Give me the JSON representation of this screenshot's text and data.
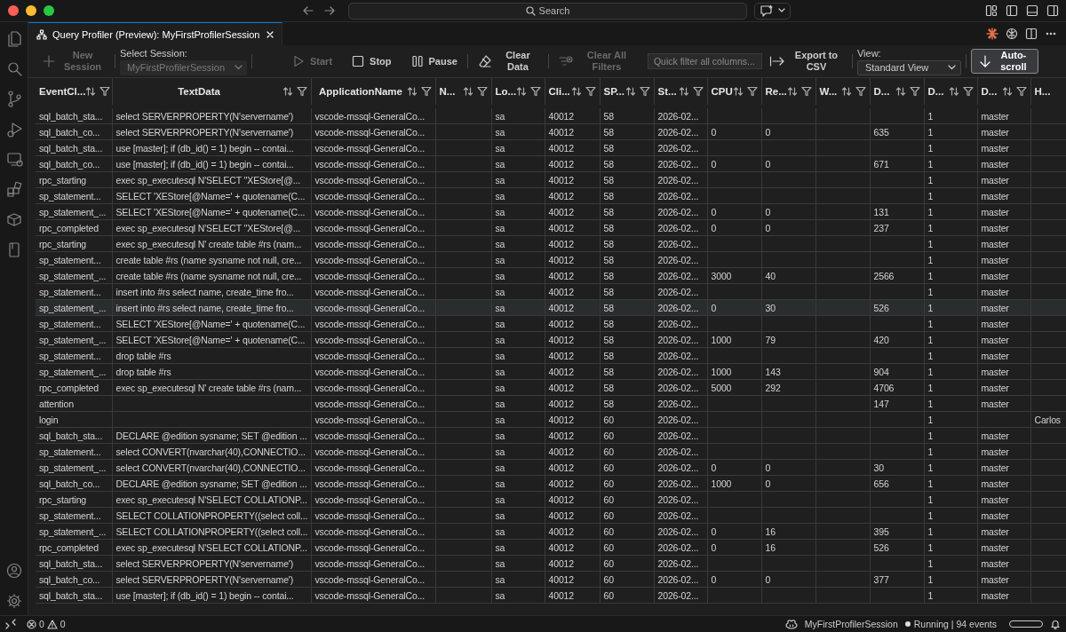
{
  "title_bar": {
    "search": "Search"
  },
  "tab": {
    "title": "Query Profiler (Preview): MyFirstProfilerSession",
    "selected": true
  },
  "toolbar": [
    {
      "kind": "button",
      "label": "New Session",
      "disabled": true
    },
    {
      "kind": "dropdown",
      "label": "Select Session:",
      "value": "MyFirstProfilerSession",
      "disabled": true
    },
    {
      "kind": "button",
      "label": "Start",
      "disabled": true
    },
    {
      "kind": "button",
      "label": "Stop",
      "disabled": false
    },
    {
      "kind": "button",
      "label": "Pause",
      "disabled": false
    },
    {
      "kind": "button",
      "label": "Clear Data",
      "disabled": false
    },
    {
      "kind": "button",
      "label": "Clear All Filters",
      "disabled": true
    },
    {
      "kind": "filter",
      "placeholder": "Quick filter all columns..."
    },
    {
      "kind": "button",
      "label": "Export to CSV",
      "disabled": false
    },
    {
      "kind": "dropdown",
      "label": "View:",
      "value": "Standard View",
      "disabled": false
    },
    {
      "kind": "toggle",
      "label": "Auto-scroll",
      "on": true
    }
  ],
  "table": {
    "columns": [
      "EventCl...",
      "TextData",
      "ApplicationName",
      "N...",
      "Lo...",
      "Cli...",
      "SP...",
      "St...",
      "CPU",
      "Re...",
      "W...",
      "D...",
      "D...",
      "D...",
      "H..."
    ],
    "rows": [
      {
        "selected": false,
        "cells": [
          "sql_batch_sta...",
          "select SERVERPROPERTY(N'servername')",
          "vscode-mssql-GeneralCo...",
          null,
          "sa",
          "40012",
          "58",
          "2026-02...",
          null,
          null,
          null,
          null,
          "1",
          "master",
          null
        ]
      },
      {
        "selected": false,
        "cells": [
          "sql_batch_co...",
          "select SERVERPROPERTY(N'servername')",
          "vscode-mssql-GeneralCo...",
          null,
          "sa",
          "40012",
          "58",
          "2026-02...",
          "0",
          "0",
          null,
          "635",
          "1",
          "master",
          null
        ]
      },
      {
        "selected": false,
        "cells": [
          "sql_batch_sta...",
          "use [master]; if (db_id() = 1) begin -- contai...",
          "vscode-mssql-GeneralCo...",
          null,
          "sa",
          "40012",
          "58",
          "2026-02...",
          null,
          null,
          null,
          null,
          "1",
          "master",
          null
        ]
      },
      {
        "selected": false,
        "cells": [
          "sql_batch_co...",
          "use [master]; if (db_id() = 1) begin -- contai...",
          "vscode-mssql-GeneralCo...",
          null,
          "sa",
          "40012",
          "58",
          "2026-02...",
          "0",
          "0",
          null,
          "671",
          "1",
          "master",
          null
        ]
      },
      {
        "selected": false,
        "cells": [
          "rpc_starting",
          "exec sp_executesql N'SELECT ''XEStore[@...",
          "vscode-mssql-GeneralCo...",
          null,
          "sa",
          "40012",
          "58",
          "2026-02...",
          null,
          null,
          null,
          null,
          "1",
          "master",
          null
        ]
      },
      {
        "selected": false,
        "cells": [
          "sp_statement...",
          "SELECT 'XEStore[@Name=' + quotename(C...",
          "vscode-mssql-GeneralCo...",
          null,
          "sa",
          "40012",
          "58",
          "2026-02...",
          null,
          null,
          null,
          null,
          "1",
          "master",
          null
        ]
      },
      {
        "selected": false,
        "cells": [
          "sp_statement_...",
          "SELECT 'XEStore[@Name=' + quotename(C...",
          "vscode-mssql-GeneralCo...",
          null,
          "sa",
          "40012",
          "58",
          "2026-02...",
          "0",
          "0",
          null,
          "131",
          "1",
          "master",
          null
        ]
      },
      {
        "selected": false,
        "cells": [
          "rpc_completed",
          "exec sp_executesql N'SELECT ''XEStore[@...",
          "vscode-mssql-GeneralCo...",
          null,
          "sa",
          "40012",
          "58",
          "2026-02...",
          "0",
          "0",
          null,
          "237",
          "1",
          "master",
          null
        ]
      },
      {
        "selected": false,
        "cells": [
          "rpc_starting",
          "exec sp_executesql N' create table #rs (nam...",
          "vscode-mssql-GeneralCo...",
          null,
          "sa",
          "40012",
          "58",
          "2026-02...",
          null,
          null,
          null,
          null,
          "1",
          "master",
          null
        ]
      },
      {
        "selected": false,
        "cells": [
          "sp_statement...",
          "create table #rs (name sysname not null, cre...",
          "vscode-mssql-GeneralCo...",
          null,
          "sa",
          "40012",
          "58",
          "2026-02...",
          null,
          null,
          null,
          null,
          "1",
          "master",
          null
        ]
      },
      {
        "selected": false,
        "cells": [
          "sp_statement_...",
          "create table #rs (name sysname not null, cre...",
          "vscode-mssql-GeneralCo...",
          null,
          "sa",
          "40012",
          "58",
          "2026-02...",
          "3000",
          "40",
          null,
          "2566",
          "1",
          "master",
          null
        ]
      },
      {
        "selected": false,
        "cells": [
          "sp_statement...",
          "insert into #rs select name, create_time fro...",
          "vscode-mssql-GeneralCo...",
          null,
          "sa",
          "40012",
          "58",
          "2026-02...",
          null,
          null,
          null,
          null,
          "1",
          "master",
          null
        ]
      },
      {
        "selected": true,
        "cells": [
          "sp_statement_...",
          "insert into #rs select name, create_time fro...",
          "vscode-mssql-GeneralCo...",
          null,
          "sa",
          "40012",
          "58",
          "2026-02...",
          "0",
          "30",
          null,
          "526",
          "1",
          "master",
          null
        ]
      },
      {
        "selected": false,
        "cells": [
          "sp_statement...",
          "SELECT 'XEStore[@Name=' + quotename(C...",
          "vscode-mssql-GeneralCo...",
          null,
          "sa",
          "40012",
          "58",
          "2026-02...",
          null,
          null,
          null,
          null,
          "1",
          "master",
          null
        ]
      },
      {
        "selected": false,
        "cells": [
          "sp_statement_...",
          "SELECT 'XEStore[@Name=' + quotename(C...",
          "vscode-mssql-GeneralCo...",
          null,
          "sa",
          "40012",
          "58",
          "2026-02...",
          "1000",
          "79",
          null,
          "420",
          "1",
          "master",
          null
        ]
      },
      {
        "selected": false,
        "cells": [
          "sp_statement...",
          "drop table #rs",
          "vscode-mssql-GeneralCo...",
          null,
          "sa",
          "40012",
          "58",
          "2026-02...",
          null,
          null,
          null,
          null,
          "1",
          "master",
          null
        ]
      },
      {
        "selected": false,
        "cells": [
          "sp_statement_...",
          "drop table #rs",
          "vscode-mssql-GeneralCo...",
          null,
          "sa",
          "40012",
          "58",
          "2026-02...",
          "1000",
          "143",
          null,
          "904",
          "1",
          "master",
          null
        ]
      },
      {
        "selected": false,
        "cells": [
          "rpc_completed",
          "exec sp_executesql N' create table #rs (nam...",
          "vscode-mssql-GeneralCo...",
          null,
          "sa",
          "40012",
          "58",
          "2026-02...",
          "5000",
          "292",
          null,
          "4706",
          "1",
          "master",
          null
        ]
      },
      {
        "selected": false,
        "cells": [
          "attention",
          null,
          "vscode-mssql-GeneralCo...",
          null,
          "sa",
          "40012",
          "58",
          "2026-02...",
          null,
          null,
          null,
          "147",
          "1",
          "master",
          null
        ]
      },
      {
        "selected": false,
        "cells": [
          "login",
          null,
          "vscode-mssql-GeneralCo...",
          null,
          "sa",
          "40012",
          "60",
          "2026-02...",
          null,
          null,
          null,
          null,
          "1",
          null,
          "Carlos"
        ]
      },
      {
        "selected": false,
        "cells": [
          "sql_batch_sta...",
          "DECLARE @edition sysname; SET @edition ...",
          "vscode-mssql-GeneralCo...",
          null,
          "sa",
          "40012",
          "60",
          "2026-02...",
          null,
          null,
          null,
          null,
          "1",
          "master",
          null
        ]
      },
      {
        "selected": false,
        "cells": [
          "sp_statement...",
          "select CONVERT(nvarchar(40),CONNECTIO...",
          "vscode-mssql-GeneralCo...",
          null,
          "sa",
          "40012",
          "60",
          "2026-02...",
          null,
          null,
          null,
          null,
          "1",
          "master",
          null
        ]
      },
      {
        "selected": false,
        "cells": [
          "sp_statement_...",
          "select CONVERT(nvarchar(40),CONNECTIO...",
          "vscode-mssql-GeneralCo...",
          null,
          "sa",
          "40012",
          "60",
          "2026-02...",
          "0",
          "0",
          null,
          "30",
          "1",
          "master",
          null
        ]
      },
      {
        "selected": false,
        "cells": [
          "sql_batch_co...",
          "DECLARE @edition sysname; SET @edition ...",
          "vscode-mssql-GeneralCo...",
          null,
          "sa",
          "40012",
          "60",
          "2026-02...",
          "1000",
          "0",
          null,
          "656",
          "1",
          "master",
          null
        ]
      },
      {
        "selected": false,
        "cells": [
          "rpc_starting",
          "exec sp_executesql N'SELECT COLLATIONP...",
          "vscode-mssql-GeneralCo...",
          null,
          "sa",
          "40012",
          "60",
          "2026-02...",
          null,
          null,
          null,
          null,
          "1",
          "master",
          null
        ]
      },
      {
        "selected": false,
        "cells": [
          "sp_statement...",
          "SELECT COLLATIONPROPERTY((select coll...",
          "vscode-mssql-GeneralCo...",
          null,
          "sa",
          "40012",
          "60",
          "2026-02...",
          null,
          null,
          null,
          null,
          "1",
          "master",
          null
        ]
      },
      {
        "selected": false,
        "cells": [
          "sp_statement_...",
          "SELECT COLLATIONPROPERTY((select coll...",
          "vscode-mssql-GeneralCo...",
          null,
          "sa",
          "40012",
          "60",
          "2026-02...",
          "0",
          "16",
          null,
          "395",
          "1",
          "master",
          null
        ]
      },
      {
        "selected": false,
        "cells": [
          "rpc_completed",
          "exec sp_executesql N'SELECT COLLATIONP...",
          "vscode-mssql-GeneralCo...",
          null,
          "sa",
          "40012",
          "60",
          "2026-02...",
          "0",
          "16",
          null,
          "526",
          "1",
          "master",
          null
        ]
      },
      {
        "selected": false,
        "cells": [
          "sql_batch_sta...",
          "select SERVERPROPERTY(N'servername')",
          "vscode-mssql-GeneralCo...",
          null,
          "sa",
          "40012",
          "60",
          "2026-02...",
          null,
          null,
          null,
          null,
          "1",
          "master",
          null
        ]
      },
      {
        "selected": false,
        "cells": [
          "sql_batch_co...",
          "select SERVERPROPERTY(N'servername')",
          "vscode-mssql-GeneralCo...",
          null,
          "sa",
          "40012",
          "60",
          "2026-02...",
          "0",
          "0",
          null,
          "377",
          "1",
          "master",
          null
        ]
      },
      {
        "selected": false,
        "cells": [
          "sql_batch_sta...",
          "use [master]; if (db_id() = 1) begin -- contai...",
          "vscode-mssql-GeneralCo...",
          null,
          "sa",
          "40012",
          "60",
          "2026-02...",
          null,
          null,
          null,
          null,
          "1",
          "master",
          null
        ]
      }
    ]
  },
  "status_bar": {
    "errors": "0",
    "warnings": "0",
    "session": "MyFirstProfilerSession",
    "state": "Running | 94 events"
  }
}
